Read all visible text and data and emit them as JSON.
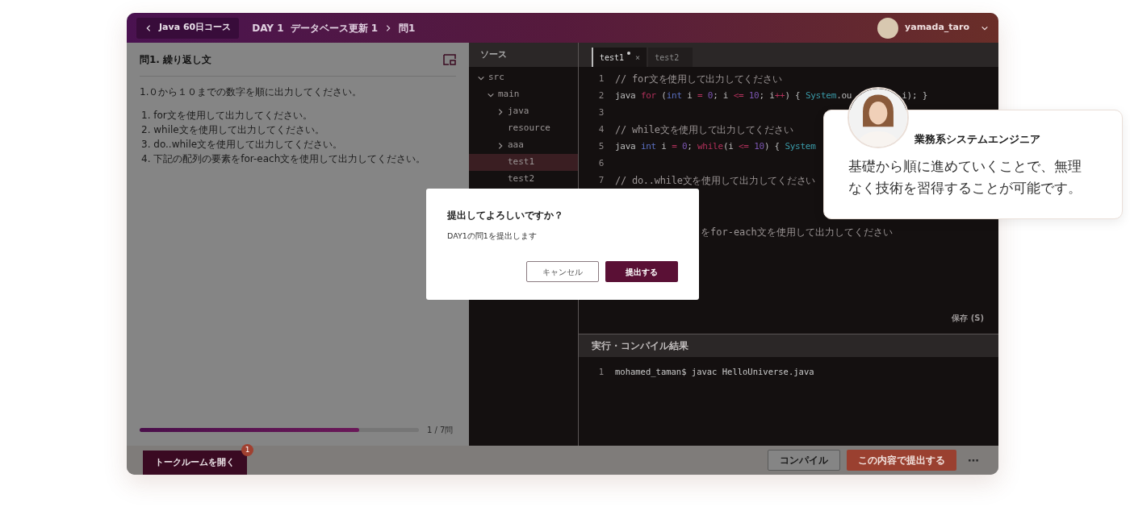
{
  "header": {
    "back_button": "Java 60日コース",
    "breadcrumb": [
      "DAY 1",
      "データベース更新 1",
      "問1"
    ],
    "user": {
      "name": "yamada_taro"
    }
  },
  "problem": {
    "title": "問1. 繰り返し文",
    "intro": "1.０から１０までの数字を順に出力してください。",
    "items": [
      "1. for文を使用して出力してください。",
      "2. while文を使用して出力してください。",
      "3. do..while文を使用して出力してください。",
      "4. 下記の配列の要素をfor-each文を使用して出力してください。"
    ],
    "progress": {
      "level": 0.785,
      "reading": "1 / 7問"
    }
  },
  "source": {
    "title": "ソース",
    "tree": [
      {
        "label": "src",
        "expanded": true,
        "selected": false,
        "children": [
          {
            "label": "main",
            "expanded": true,
            "selected": false,
            "children": [
              {
                "label": "java",
                "expanded": false,
                "selected": false
              },
              {
                "label": "resource",
                "selected": false
              },
              {
                "label": "aaa",
                "expanded": false,
                "selected": false
              },
              {
                "label": "test1",
                "selected": true
              },
              {
                "label": "test2",
                "selected": false
              }
            ]
          }
        ]
      }
    ]
  },
  "editor": {
    "tabs": [
      {
        "label": "test1",
        "selected": true,
        "modified": true,
        "close": "×"
      },
      {
        "label": "test2",
        "selected": false,
        "modified": false
      }
    ],
    "lines": [
      {
        "number": "1",
        "tokens": [
          {
            "kind": "comment",
            "text": "// for文を使用して出力してください"
          }
        ]
      },
      {
        "number": "2",
        "tokens": [
          {
            "kind": "plain",
            "text": "java "
          },
          {
            "kind": "keyword",
            "text": "for"
          },
          {
            "kind": "plain",
            "text": " ("
          },
          {
            "kind": "type",
            "text": "int"
          },
          {
            "kind": "plain",
            "text": " i "
          },
          {
            "kind": "operator",
            "text": "= "
          },
          {
            "kind": "number",
            "text": "0"
          },
          {
            "kind": "plain",
            "text": "; i "
          },
          {
            "kind": "operator",
            "text": "<= "
          },
          {
            "kind": "number",
            "text": "10"
          },
          {
            "kind": "plain",
            "text": "; i"
          },
          {
            "kind": "operator",
            "text": "++"
          },
          {
            "kind": "plain",
            "text": ") { "
          },
          {
            "kind": "class",
            "text": "System"
          },
          {
            "kind": "plain",
            "text": ".ou"
          }
        ],
        "tail": "i); }"
      },
      {
        "number": "3"
      },
      {
        "number": "4",
        "tokens": [
          {
            "kind": "comment",
            "text": "// while文を使用して出力してください"
          }
        ]
      },
      {
        "number": "5",
        "tokens": [
          {
            "kind": "plain",
            "text": "java "
          },
          {
            "kind": "type",
            "text": "int"
          },
          {
            "kind": "plain",
            "text": " i "
          },
          {
            "kind": "operator",
            "text": "= "
          },
          {
            "kind": "number",
            "text": "0"
          },
          {
            "kind": "plain",
            "text": "; "
          },
          {
            "kind": "keyword",
            "text": "while"
          },
          {
            "kind": "plain",
            "text": "(i "
          },
          {
            "kind": "operator",
            "text": "<= "
          },
          {
            "kind": "number",
            "text": "10"
          },
          {
            "kind": "plain",
            "text": ") { "
          },
          {
            "kind": "class",
            "text": "System"
          }
        ]
      },
      {
        "number": "6"
      },
      {
        "number": "7",
        "tokens": [
          {
            "kind": "comment",
            "text": "// do..while文を使用して出力してください"
          }
        ]
      }
    ],
    "partial_line": "をfor-each文を使用して出力してください",
    "save": "保存 (S)"
  },
  "output": {
    "title": "実行・コンパイル結果",
    "lines": [
      {
        "number": "1",
        "text": "mohamed_taman$ javac HelloUniverse.java"
      }
    ]
  },
  "footer": {
    "talk_button": "トークルームを開く",
    "badge": "1",
    "compile_button": "コンパイル",
    "submit_button": "この内容で提出する",
    "more": "⋯"
  },
  "dialog": {
    "title": "提出してよろしいですか？",
    "message": "DAY1の問1を提出します",
    "cancel": "キャンセル",
    "confirm": "提出する"
  },
  "testimonial": {
    "role": "業務系システムエンジニア",
    "quote": "基礎から順に進めていくことで、無理なく技術を習得することが可能です。"
  }
}
